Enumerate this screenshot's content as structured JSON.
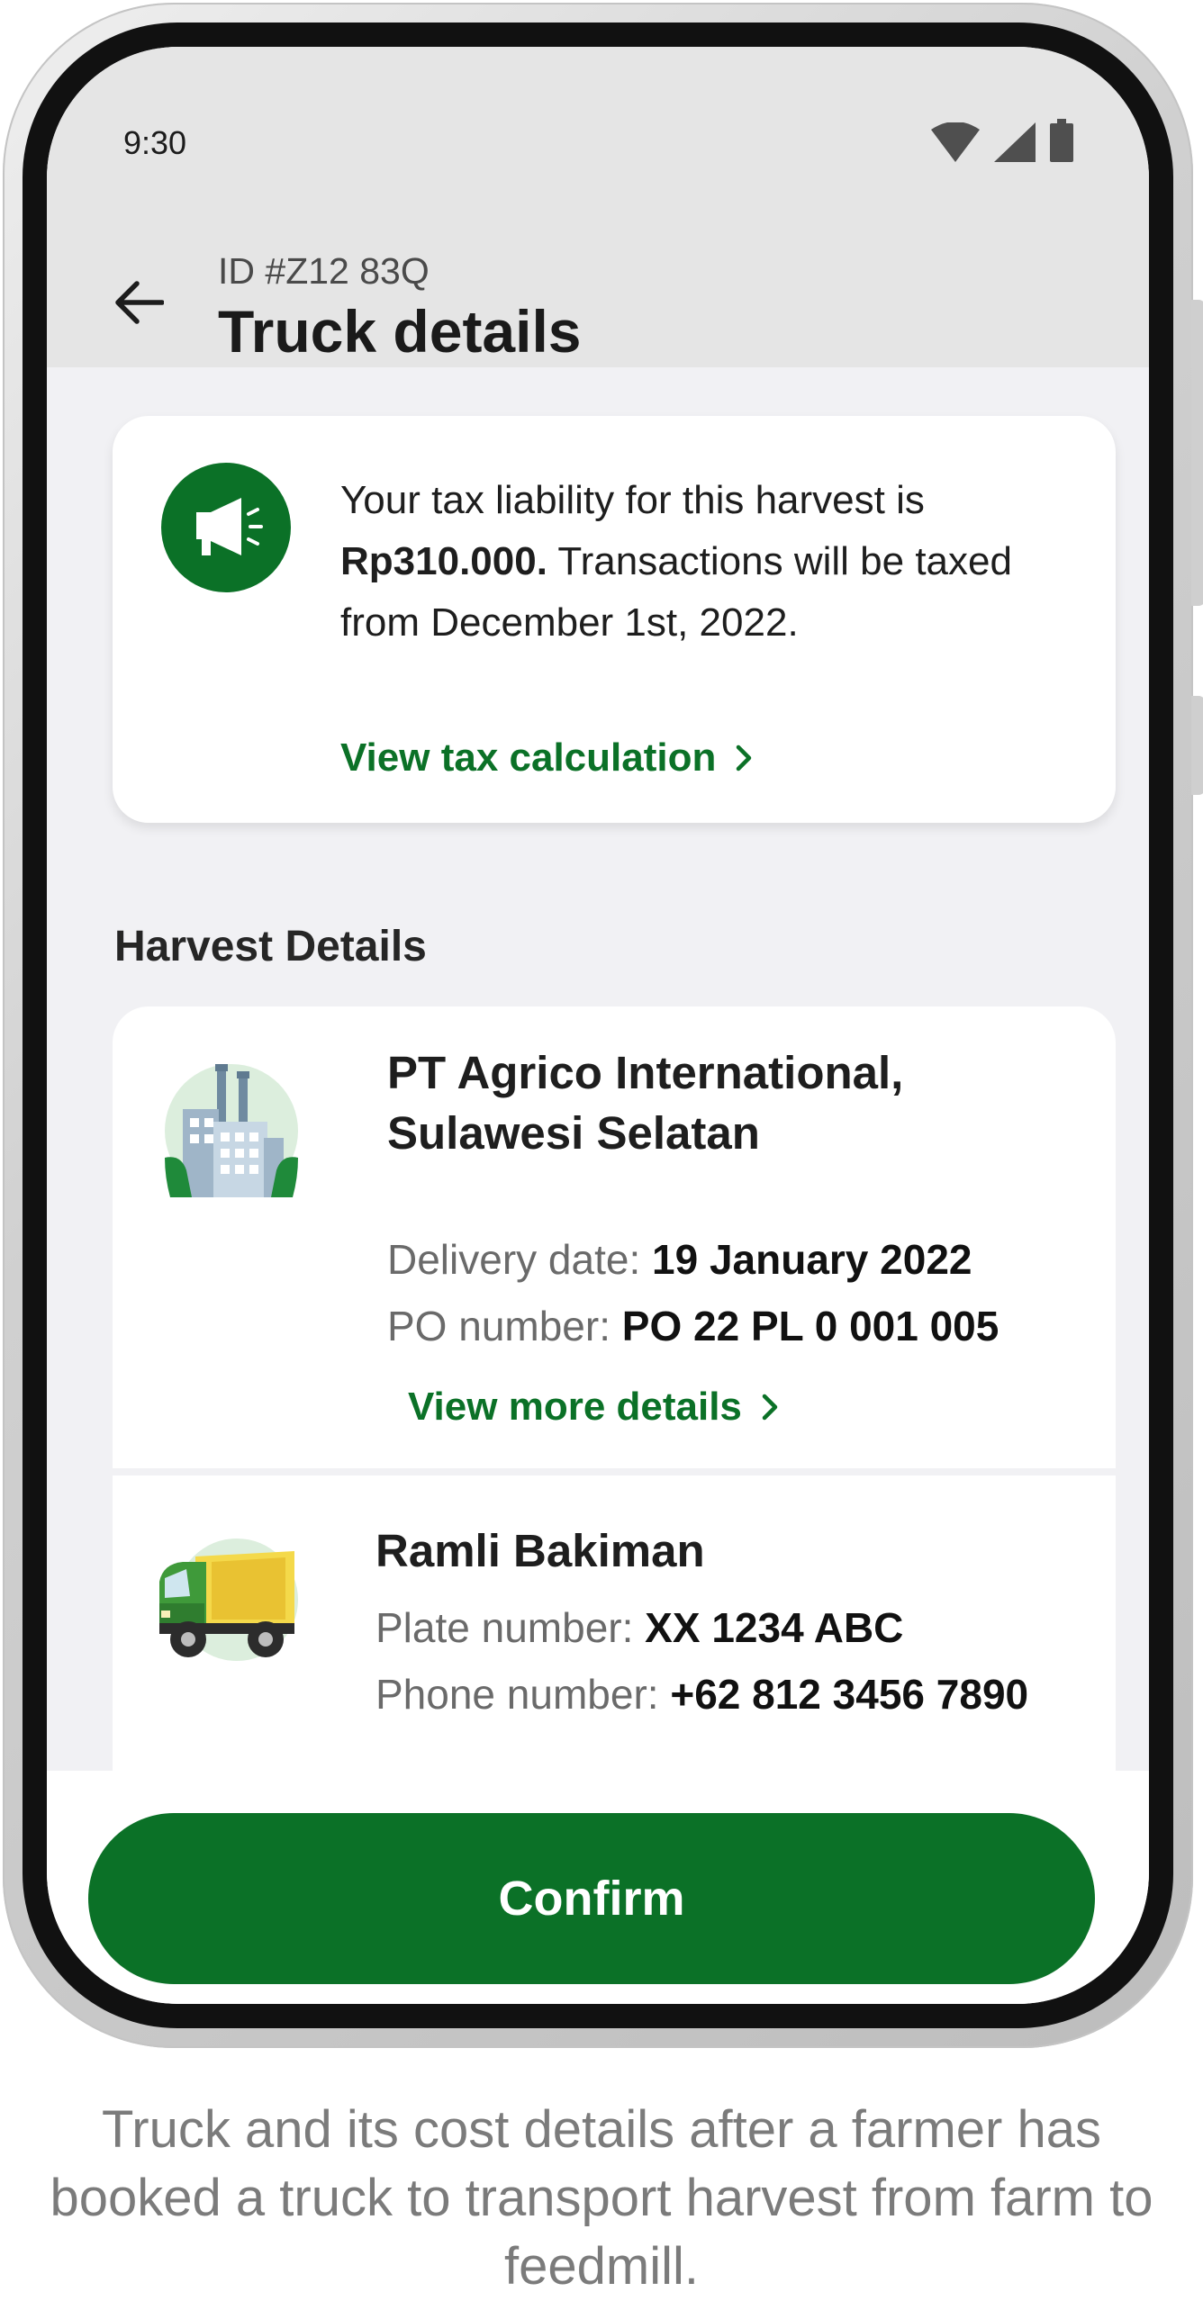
{
  "status_bar": {
    "time": "9:30"
  },
  "header": {
    "id_label": "ID #Z12 83Q",
    "title": "Truck details"
  },
  "tax_notice": {
    "line1": "Your tax liability for this harvest is",
    "amount": "Rp310.000.",
    "after_amount": " Transactions will be taxed from December 1st, 2022.",
    "link": "View tax calculation"
  },
  "section": {
    "title": "Harvest Details"
  },
  "harvest": {
    "company_line1": "PT Agrico International,",
    "company_line2": "Sulawesi Selatan",
    "delivery_label": "Delivery date:",
    "delivery_value": "19 January 2022",
    "po_label": "PO number:",
    "po_value": "PO 22 PL 0 001 005",
    "link": "View more details"
  },
  "driver": {
    "name": "Ramli Bakiman",
    "plate_label": "Plate number:",
    "plate_value": "XX 1234 ABC",
    "phone_label": "Phone number:",
    "phone_value": "+62 812 3456 7890"
  },
  "footer": {
    "confirm_label": "Confirm"
  },
  "caption": "Truck and its cost details after a farmer has booked a truck to transport harvest from farm to feedmill.",
  "icons": [
    "arrow-left-icon",
    "megaphone-icon",
    "chevron-right-icon",
    "factory-icon",
    "truck-icon",
    "wifi-icon",
    "signal-icon",
    "battery-icon"
  ],
  "colors": {
    "primary": "#0b7127",
    "truck_yellow": "#f4d94a",
    "truck_green": "#3f9a3a"
  }
}
